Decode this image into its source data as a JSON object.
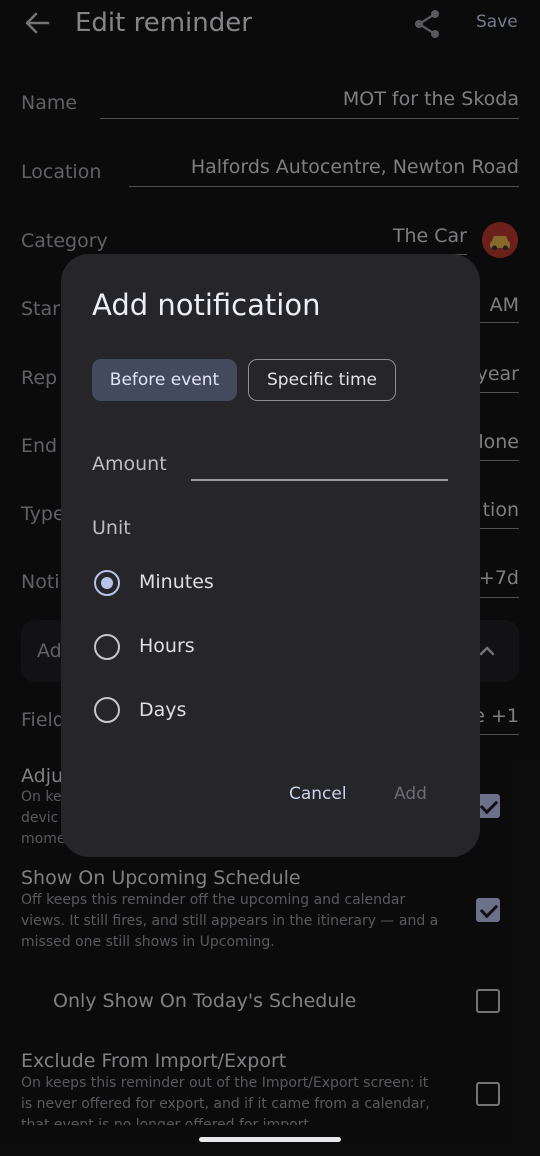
{
  "app_bar": {
    "title": "Edit reminder",
    "save_label": "Save",
    "back_icon": "arrow-back-icon",
    "share_icon": "share-icon"
  },
  "fields": {
    "name": {
      "label": "Name",
      "value": "MOT for the Skoda"
    },
    "location": {
      "label": "Location",
      "value": "Halfords Autocentre, Newton Road"
    },
    "category": {
      "label": "Category",
      "value": "The Car",
      "icon": "car-icon"
    },
    "start": {
      "label": "Star",
      "value": "AM"
    },
    "repeat": {
      "label": "Rep",
      "value": "year"
    },
    "end": {
      "label": "End",
      "value": "lone"
    },
    "type": {
      "label": "Type",
      "value": "tion"
    },
    "notifications": {
      "label": "Noti",
      "value": "+7d"
    },
    "advanced": {
      "label": "Ad"
    },
    "fields": {
      "label": "Field",
      "value": "e +1"
    }
  },
  "switches": {
    "adjust": {
      "title": "Adju",
      "desc_lines": [
        "On kee",
        "devic",
        "mome"
      ],
      "checked": true
    },
    "upcoming": {
      "title": "Show On Upcoming Schedule",
      "desc_lines": [
        "Off keeps this reminder off the upcoming and calendar",
        "views. It still fires, and still appears in the itinerary — and a",
        "missed one still shows in Upcoming."
      ],
      "checked": true
    },
    "today": {
      "title": "Only Show On Today's Schedule",
      "checked": false
    },
    "exclude": {
      "title": "Exclude From Import/Export",
      "desc_lines": [
        "On keeps this reminder out of the Import/Export screen: it",
        "is never offered for export, and if it came from a calendar,",
        "that event is no longer offered for import."
      ],
      "checked": false
    }
  },
  "dialog": {
    "title": "Add notification",
    "segments": [
      {
        "label": "Before event",
        "selected": true
      },
      {
        "label": "Specific time",
        "selected": false
      }
    ],
    "amount": {
      "label": "Amount",
      "value": ""
    },
    "unit_label": "Unit",
    "units": [
      {
        "label": "Minutes",
        "selected": true
      },
      {
        "label": "Hours",
        "selected": false
      },
      {
        "label": "Days",
        "selected": false
      }
    ],
    "cancel_label": "Cancel",
    "add_label": "Add"
  },
  "colors": {
    "background": "#141416",
    "dialog": "#25252a",
    "accent": "#b9c3ea",
    "segment_selected": "#434a5d"
  }
}
